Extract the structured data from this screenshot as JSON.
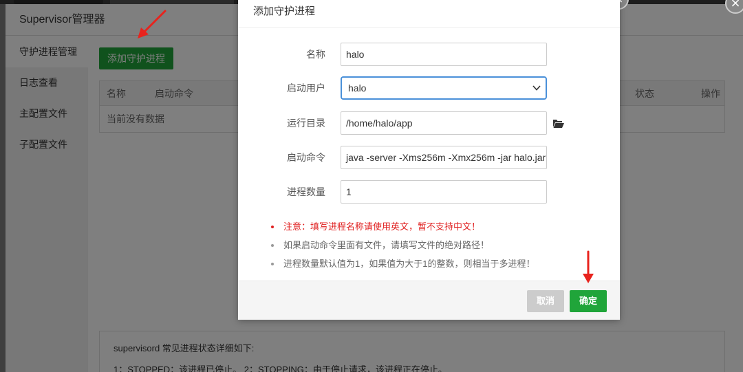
{
  "background": {
    "panel_title": "Supervisor管理器",
    "sidebar": {
      "items": [
        {
          "label": "守护进程管理"
        },
        {
          "label": "日志查看"
        },
        {
          "label": "主配置文件"
        },
        {
          "label": "子配置文件"
        }
      ]
    },
    "add_button_label": "添加守护进程",
    "table": {
      "headers": [
        "名称",
        "启动命令",
        "状态",
        "操作"
      ],
      "empty_text": "当前没有数据"
    },
    "info": {
      "line1": "supervisord 常见进程状态详细如下:",
      "line2": "1：STOPPED：该进程已停止。     2：STOPPING：由于停止请求，该进程正在停止。"
    }
  },
  "modal": {
    "title": "添加守护进程",
    "fields": {
      "name": {
        "label": "名称",
        "value": "halo"
      },
      "user": {
        "label": "启动用户",
        "value": "halo"
      },
      "dir": {
        "label": "运行目录",
        "value": "/home/halo/app"
      },
      "command": {
        "label": "启动命令",
        "value": "java -server -Xms256m -Xmx256m -jar halo.jar"
      },
      "count": {
        "label": "进程数量",
        "value": "1"
      }
    },
    "tips": [
      "注意：填写进程名称请使用英文，暂不支持中文！",
      "如果启动命令里面有文件，请填写文件的绝对路径！",
      "进程数量默认值为1，如果值为大于1的整数，则相当于多进程！"
    ],
    "cancel_label": "取消",
    "ok_label": "确定"
  },
  "colors": {
    "primary_green": "#20a53a",
    "warning_red": "#e02020",
    "annotation_arrow": "#e8231d"
  },
  "icons": [
    "folder-open-icon",
    "chevron-down-icon",
    "close-icon",
    "annotation-arrow-icon"
  ]
}
